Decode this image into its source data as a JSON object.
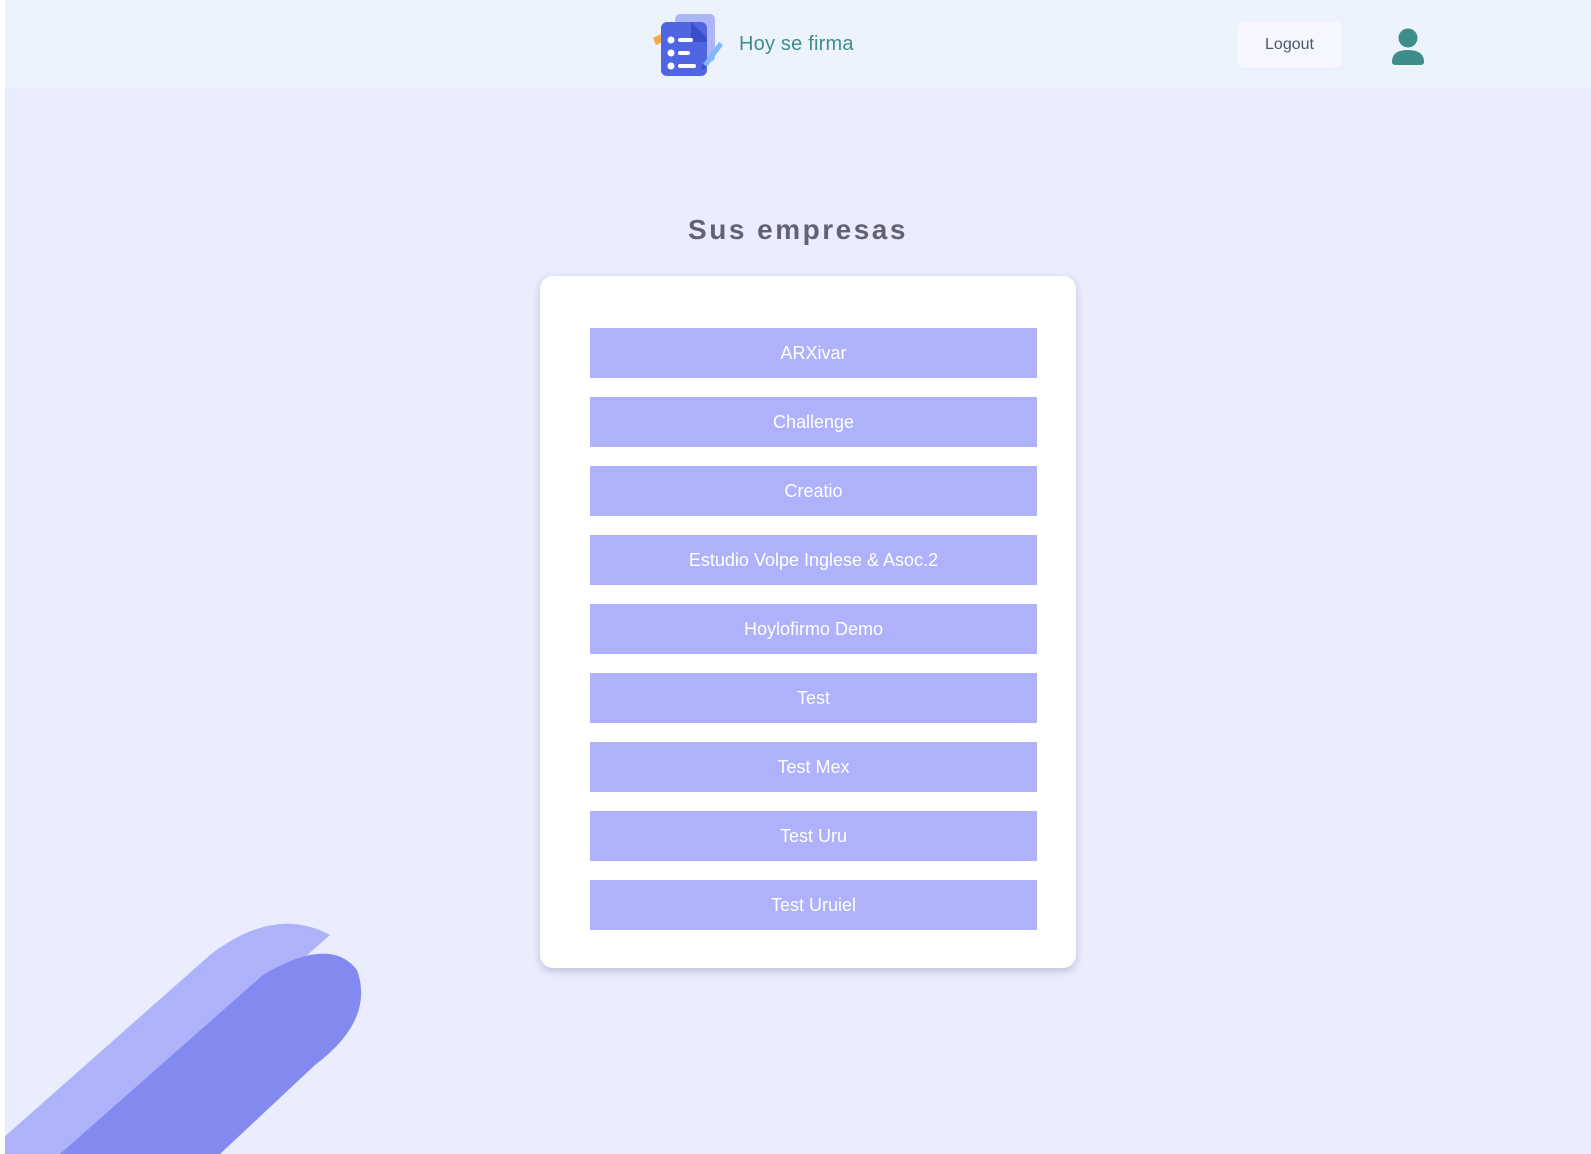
{
  "header": {
    "brand_name": "Hoy se firma",
    "logout_label": "Logout"
  },
  "main": {
    "title": "Sus empresas",
    "companies": [
      "ARXivar",
      "Challenge",
      "Creatio",
      "Estudio Volpe Inglese & Asoc.2",
      "Hoylofirmo Demo",
      "Test",
      "Test Mex",
      "Test Uru",
      "Test Uruiel"
    ]
  },
  "icons": {
    "logo": "document-list-pen-icon",
    "avatar": "user-avatar-icon"
  },
  "colors": {
    "background": "#eaedfd",
    "header": "#edf3fd",
    "brand_text": "#3f8d8b",
    "company_button": "#adb2fb",
    "deco_light": "#aeb2fb",
    "deco_dark": "#8389ef",
    "avatar": "#3f8d8b"
  }
}
